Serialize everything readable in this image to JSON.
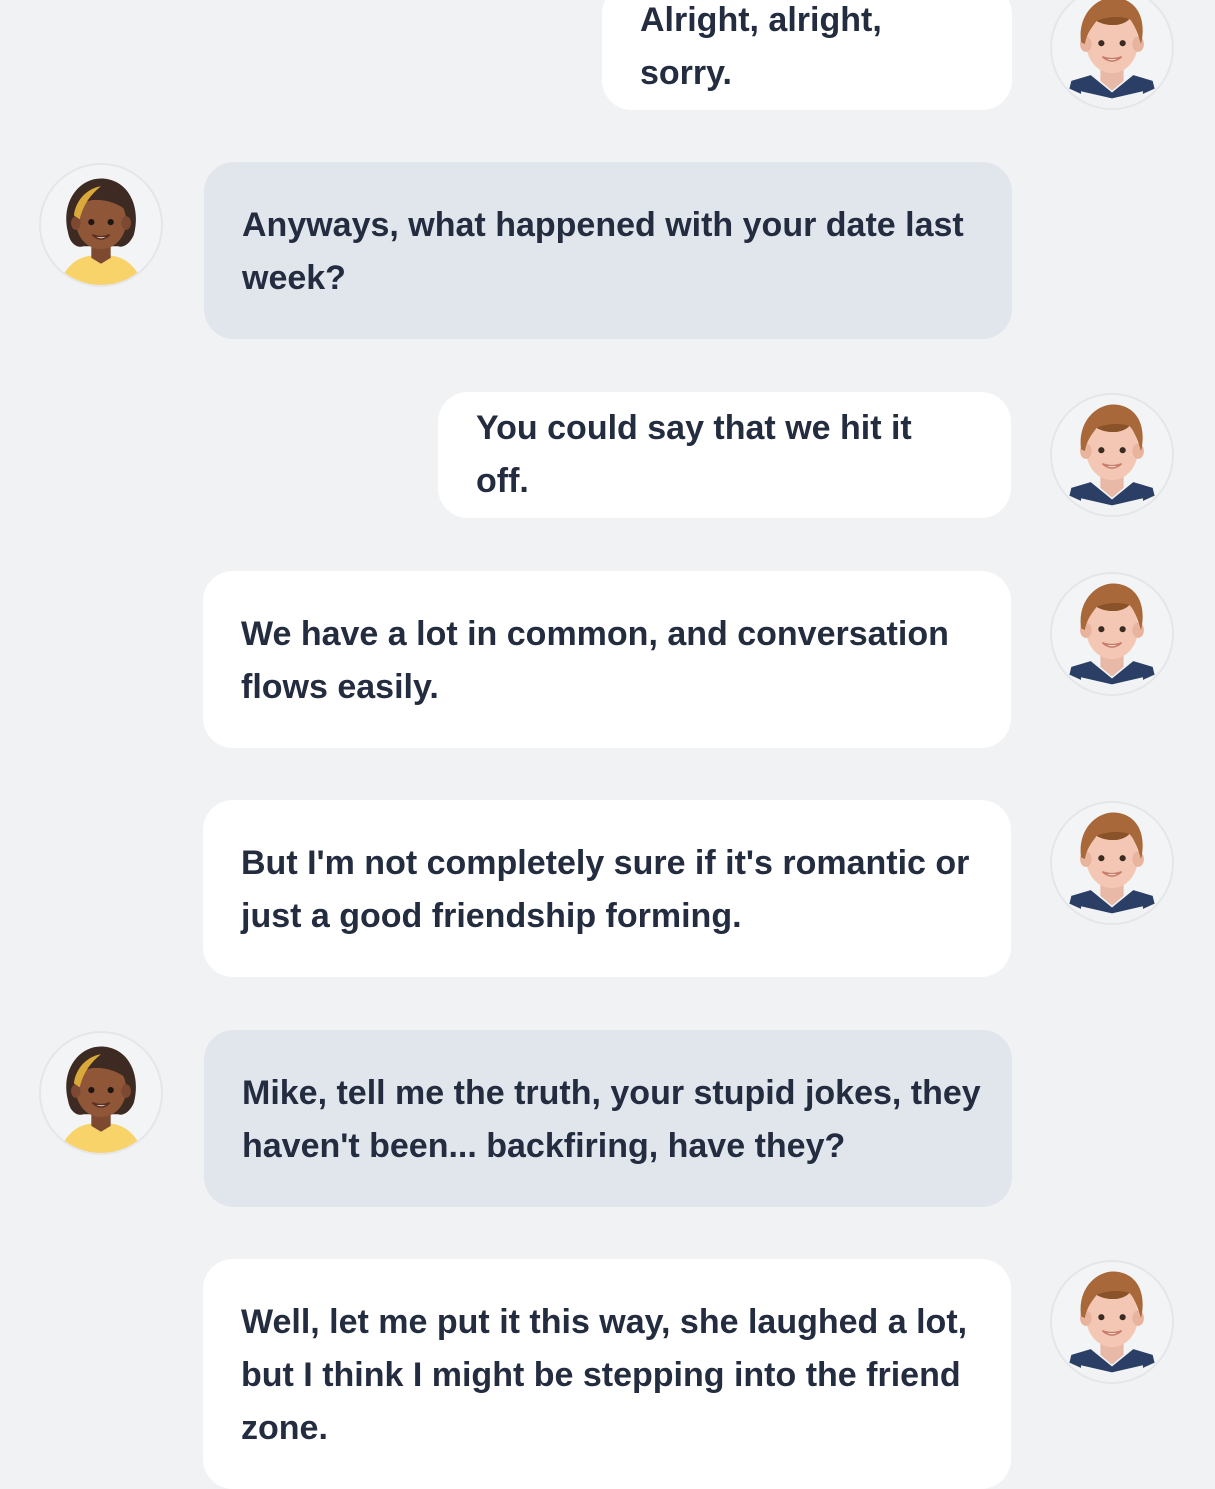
{
  "messages": [
    {
      "side": "out",
      "text": "Alright, alright, sorry."
    },
    {
      "side": "in",
      "text": "Anyways, what happened with your date last week?"
    },
    {
      "side": "out",
      "text": "You could say that we hit it off."
    },
    {
      "side": "out",
      "text": "We have a lot in common, and conversation flows easily."
    },
    {
      "side": "out",
      "text": "But I'm not completely sure if it's romantic or just a good friendship forming."
    },
    {
      "side": "in",
      "text": "Mike, tell me the truth, your stupid jokes, they haven't been... backfiring, have they?"
    },
    {
      "side": "out",
      "text": "Well, let me put it this way, she laughed a lot, but I think I might be stepping into the friend zone."
    }
  ],
  "avatars": {
    "self": {
      "icon": "boy-avatar-icon"
    },
    "other": {
      "icon": "girl-avatar-icon"
    }
  },
  "colors": {
    "background": "#f1f2f4",
    "outgoing_bubble": "#ffffff",
    "incoming_bubble": "#e1e5ec",
    "text": "#242c40"
  }
}
